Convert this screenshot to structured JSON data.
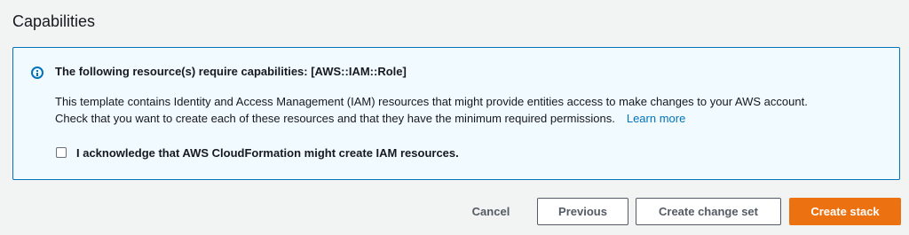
{
  "section": {
    "title": "Capabilities"
  },
  "alert": {
    "icon": "info-icon",
    "heading": "The following resource(s) require capabilities: [AWS::IAM::Role]",
    "body_line1": "This template contains Identity and Access Management (IAM) resources that might provide entities access to make changes to your AWS account.",
    "body_line2": "Check that you want to create each of these resources and that they have the minimum required permissions.",
    "learn_more": "Learn more",
    "acknowledge_label": "I acknowledge that AWS CloudFormation might create IAM resources.",
    "acknowledge_checked": false
  },
  "actions": {
    "cancel": "Cancel",
    "previous": "Previous",
    "create_change_set": "Create change set",
    "create_stack": "Create stack"
  },
  "colors": {
    "accent": "#ec7211",
    "link": "#0073bb",
    "info_border": "#0073bb",
    "info_background": "#f1faff",
    "page_background": "#f2f3f3"
  }
}
